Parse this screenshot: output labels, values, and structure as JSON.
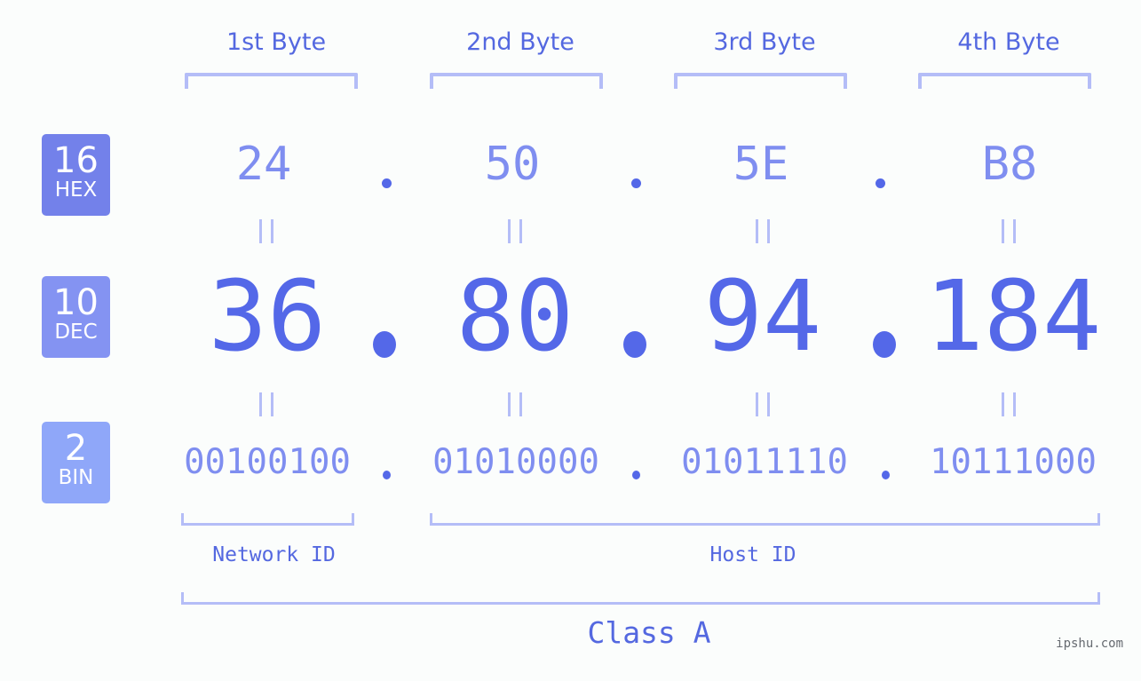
{
  "bytes": [
    {
      "label": "1st Byte",
      "hex": "24",
      "dec": "36",
      "bin": "00100100"
    },
    {
      "label": "2nd Byte",
      "hex": "50",
      "dec": "80",
      "bin": "01010000"
    },
    {
      "label": "3rd Byte",
      "hex": "5E",
      "dec": "94",
      "bin": "01011110"
    },
    {
      "label": "4th Byte",
      "hex": "B8",
      "dec": "184",
      "bin": "10111000"
    }
  ],
  "bases": {
    "hex": {
      "num": "16",
      "label": "HEX",
      "color": "#7381ea"
    },
    "dec": {
      "num": "10",
      "label": "DEC",
      "color": "#8493f2"
    },
    "bin": {
      "num": "2",
      "label": "BIN",
      "color": "#8fa7f9"
    }
  },
  "segments": {
    "network": "Network ID",
    "host": "Host ID"
  },
  "ip_class": "Class A",
  "watermark": "ipshu.com",
  "colors": {
    "accent": "#5468e8",
    "light_value": "#7f8ef0",
    "bracket": "#b4bdf7",
    "background": "#fbfdfc"
  }
}
